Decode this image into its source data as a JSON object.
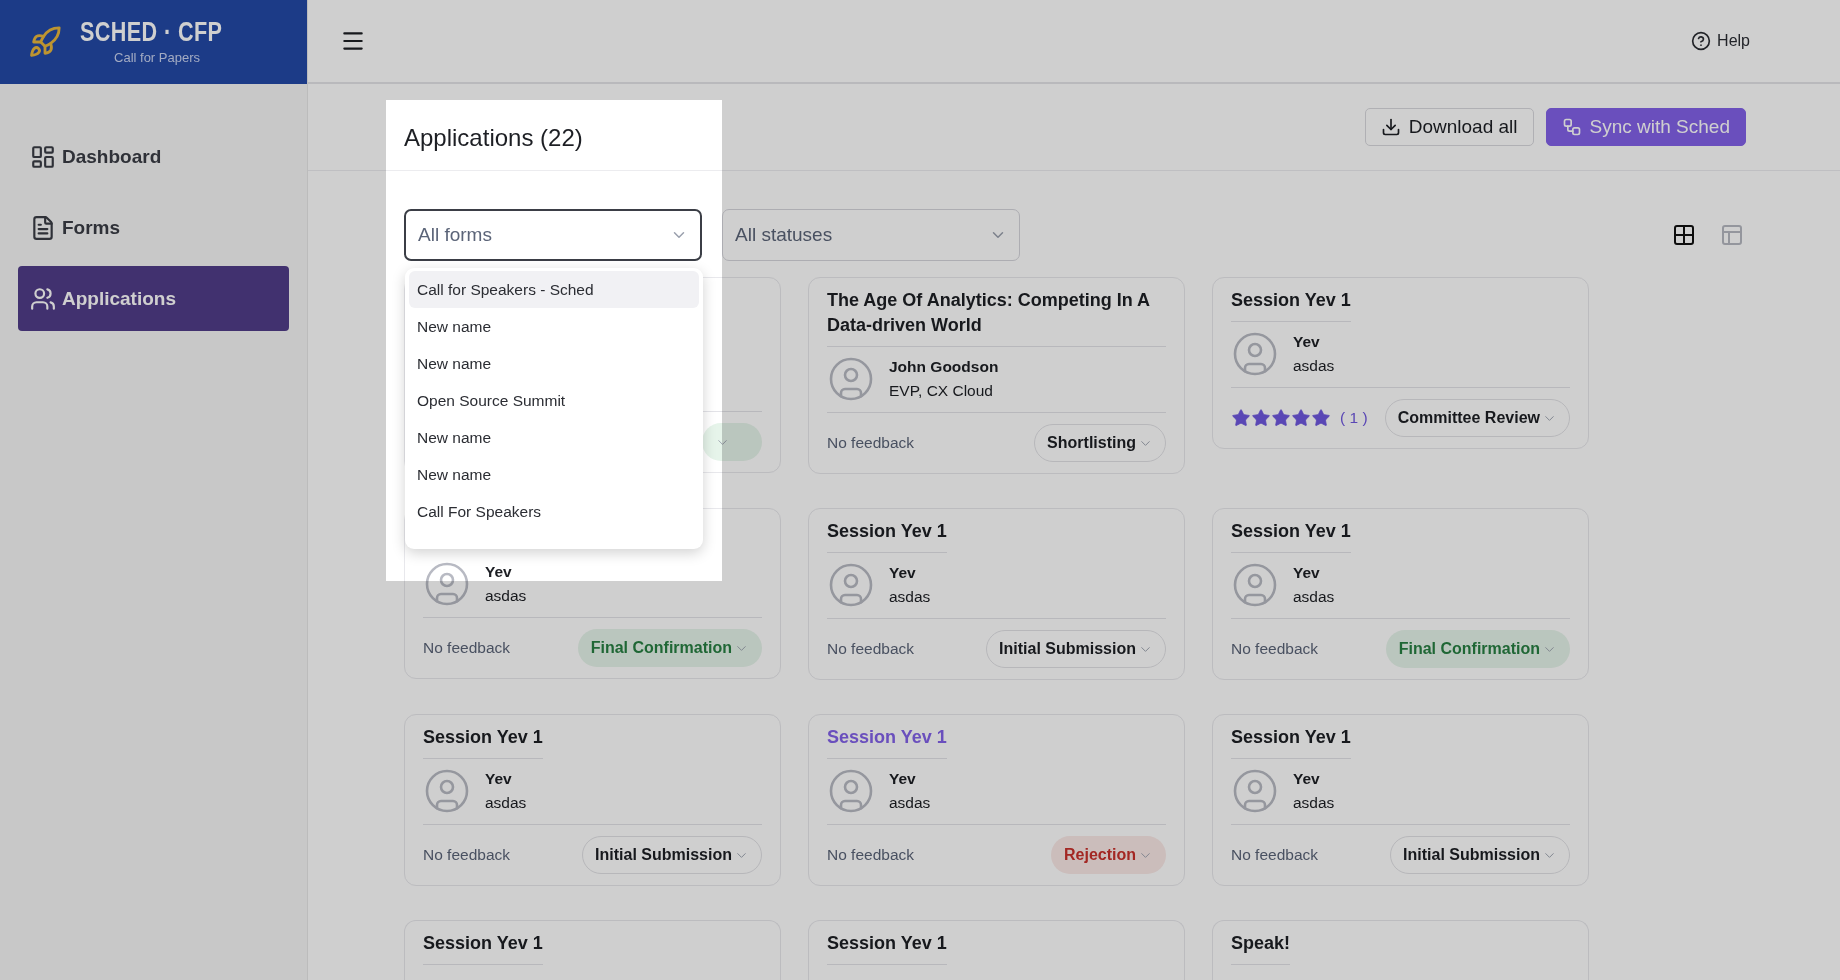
{
  "logo": {
    "title": "SCHED · CFP",
    "subtitle": "Call for Papers"
  },
  "sidebar": {
    "items": [
      {
        "label": "Dashboard",
        "kind": "dashboard",
        "selected": false
      },
      {
        "label": "Forms",
        "kind": "forms",
        "selected": false
      },
      {
        "label": "Applications",
        "kind": "applications",
        "selected": true
      }
    ]
  },
  "topbar": {
    "help": "Help"
  },
  "page": {
    "title": "Applications (22)",
    "actions": [
      {
        "label": "Download all",
        "kind": "download"
      },
      {
        "label": "Sync with Sched",
        "kind": "sync"
      }
    ]
  },
  "filters": {
    "forms_select": {
      "value": "All forms",
      "open": true,
      "options": [
        {
          "label": "Call for Speakers - Sched",
          "selected": true
        },
        {
          "label": "New name",
          "selected": false
        },
        {
          "label": "New name",
          "selected": false
        },
        {
          "label": "Open Source Summit",
          "selected": false
        },
        {
          "label": "New name",
          "selected": false
        },
        {
          "label": "New name",
          "selected": false
        },
        {
          "label": "Call For Speakers",
          "selected": false
        }
      ]
    },
    "status_select": {
      "value": "All statuses"
    },
    "views": [
      {
        "kind": "grid",
        "selected": true
      },
      {
        "kind": "layout",
        "selected": false
      }
    ]
  },
  "card_rows": [
    [
      {
        "status": {
          "kind": "positive"
        }
      },
      {
        "title": "The Age Of Analytics: Competing In A Data-driven World",
        "highlighted": false,
        "speaker": {
          "name": "John Goodson",
          "role": "EVP, CX Cloud"
        },
        "feedback": {
          "kind": "text",
          "text": "No feedback"
        },
        "status": {
          "kind": "neutral",
          "label": "Shortlisting"
        }
      },
      {
        "title": "Session Yev 1",
        "highlighted": false,
        "speaker": {
          "name": "Yev",
          "role": "asdas"
        },
        "feedback": {
          "kind": "stars",
          "stars": 5,
          "count": "( 1 )"
        },
        "status": {
          "kind": "neutral",
          "label": "Committee Review"
        }
      }
    ],
    [
      {
        "speaker": {
          "name": "Yev",
          "role": "asdas"
        },
        "feedback": {
          "kind": "text",
          "text": "No feedback"
        },
        "status": {
          "kind": "positive",
          "label": "Final Confirmation"
        }
      },
      {
        "title": "Session Yev 1",
        "highlighted": false,
        "speaker": {
          "name": "Yev",
          "role": "asdas"
        },
        "feedback": {
          "kind": "text",
          "text": "No feedback"
        },
        "status": {
          "kind": "neutral",
          "label": "Initial Submission"
        }
      },
      {
        "title": "Session Yev 1",
        "highlighted": false,
        "speaker": {
          "name": "Yev",
          "role": "asdas"
        },
        "feedback": {
          "kind": "text",
          "text": "No feedback"
        },
        "status": {
          "kind": "positive",
          "label": "Final Confirmation"
        }
      }
    ],
    [
      {
        "title": "Session Yev 1",
        "highlighted": false,
        "speaker": {
          "name": "Yev",
          "role": "asdas"
        },
        "feedback": {
          "kind": "text",
          "text": "No feedback"
        },
        "status": {
          "kind": "neutral",
          "label": "Initial Submission"
        }
      },
      {
        "title": "Session Yev 1",
        "highlighted": true,
        "speaker": {
          "name": "Yev",
          "role": "asdas"
        },
        "feedback": {
          "kind": "text",
          "text": "No feedback"
        },
        "status": {
          "kind": "negative",
          "label": "Rejection"
        }
      },
      {
        "title": "Session Yev 1",
        "highlighted": false,
        "speaker": {
          "name": "Yev",
          "role": "asdas"
        },
        "feedback": {
          "kind": "text",
          "text": "No feedback"
        },
        "status": {
          "kind": "neutral",
          "label": "Initial Submission"
        }
      }
    ],
    [
      {
        "title": "Session Yev 1",
        "highlighted": false
      },
      {
        "title": "Session Yev 1",
        "highlighted": false
      },
      {
        "title": "Speak!",
        "highlighted": false
      }
    ]
  ],
  "overlay": {
    "dimmed": true
  }
}
